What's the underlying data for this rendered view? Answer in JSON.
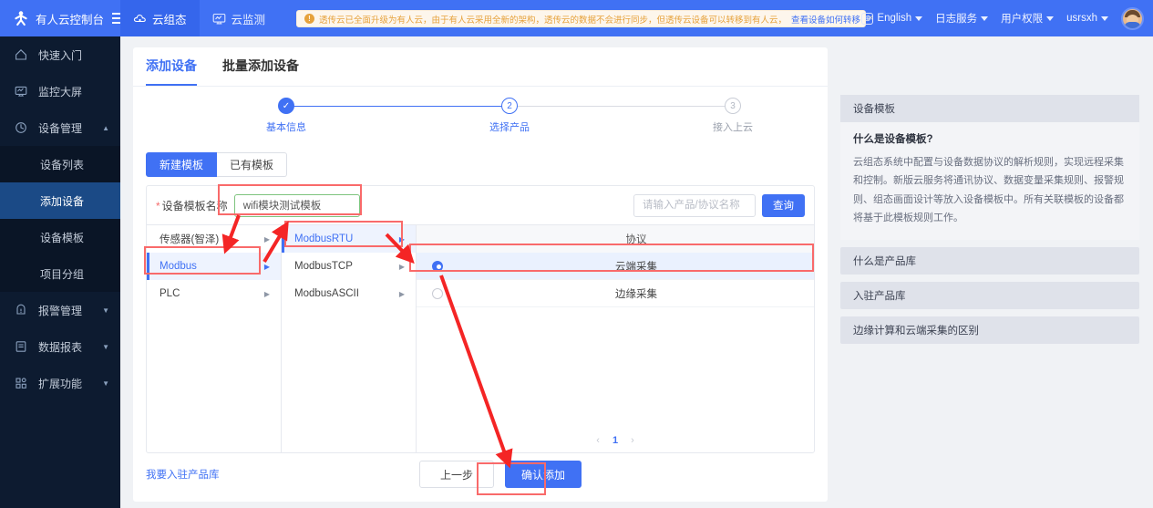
{
  "topbar": {
    "brand": "有人云控制台",
    "menu_icon": "hamburger-icon",
    "apps": [
      {
        "label": "云组态",
        "icon": "cloud-icon",
        "active": true
      },
      {
        "label": "云监测",
        "icon": "monitor-icon",
        "active": false
      }
    ],
    "notice": {
      "text": "透传云已全面升级为有人云，由于有人云采用全新的架构，透传云的数据不会进行同步，但透传云设备可以转移到有人云，",
      "link": "查看设备如何转移",
      "close": "✕",
      "icon": "!"
    },
    "right": {
      "language": "English",
      "log_service": "日志服务",
      "user_permission": "用户权限",
      "username": "usrsxh"
    }
  },
  "sidebar": {
    "items": [
      {
        "label": "快速入门",
        "icon": "home-icon"
      },
      {
        "label": "监控大屏",
        "icon": "screen-icon"
      },
      {
        "label": "设备管理",
        "icon": "device-icon",
        "expanded": true
      },
      {
        "label": "报警管理",
        "icon": "alarm-icon",
        "expanded": false
      },
      {
        "label": "数据报表",
        "icon": "report-icon",
        "expanded": false
      },
      {
        "label": "扩展功能",
        "icon": "apps-icon",
        "expanded": false
      }
    ],
    "sub_items": [
      {
        "label": "设备列表",
        "active": false
      },
      {
        "label": "添加设备",
        "active": true
      },
      {
        "label": "设备模板",
        "active": false
      },
      {
        "label": "项目分组",
        "active": false
      }
    ]
  },
  "main": {
    "tabs": [
      {
        "label": "添加设备",
        "active": true
      },
      {
        "label": "批量添加设备",
        "active": false
      }
    ],
    "steps": [
      {
        "num": "✓",
        "label": "基本信息",
        "state": "done"
      },
      {
        "num": "2",
        "label": "选择产品",
        "state": "cur"
      },
      {
        "num": "3",
        "label": "接入上云",
        "state": "todo"
      }
    ],
    "segments": [
      {
        "label": "新建模板",
        "active": true
      },
      {
        "label": "已有模板",
        "active": false
      }
    ],
    "form": {
      "template_label": "设备模板名称",
      "required_mark": "*",
      "template_value": "wifi模块测试模板",
      "search_placeholder": "请输入产品/协议名称",
      "search_value": "",
      "search_button": "查询"
    },
    "picker": {
      "col1": [
        {
          "label": "传感器(智泽)",
          "selected": false
        },
        {
          "label": "Modbus",
          "selected": true
        },
        {
          "label": "PLC",
          "selected": false
        }
      ],
      "col2": [
        {
          "label": "ModbusRTU",
          "selected": true
        },
        {
          "label": "ModbusTCP",
          "selected": false
        },
        {
          "label": "ModbusASCII",
          "selected": false
        }
      ],
      "col3_header": "协议",
      "col3": [
        {
          "label": "云端采集",
          "selected": true
        },
        {
          "label": "边缘采集",
          "selected": false
        }
      ],
      "pagination": {
        "prev": "‹",
        "page": "1",
        "next": "›"
      }
    },
    "footer": {
      "link": "我要入驻产品库",
      "prev_button": "上一步",
      "confirm_button": "确认添加"
    }
  },
  "help": {
    "panel_title": "设备模板",
    "question": "什么是设备模板?",
    "answer": "云组态系统中配置与设备数据协议的解析规则，实现远程采集和控制。新版云服务将通讯协议、数据变量采集规则、报警规则、组态画面设计等放入设备模板中。所有关联模板的设备都将基于此模板规则工作。",
    "items": [
      {
        "label": "什么是产品库"
      },
      {
        "label": "入驻产品库"
      },
      {
        "label": "边缘计算和云端采集的区别"
      }
    ]
  },
  "colors": {
    "brand_blue": "#4071f4",
    "sidebar_dark": "#0d1b30",
    "active_sub": "#1b4a86",
    "annotation_red": "#fc3d3d",
    "notice_amber": "#e6a23c",
    "input_green": "#7ec47e"
  }
}
